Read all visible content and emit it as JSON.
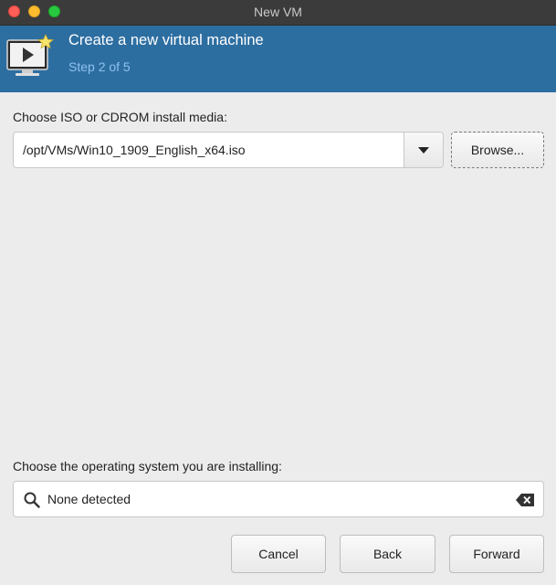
{
  "window": {
    "title": "New VM"
  },
  "banner": {
    "title": "Create a new virtual machine",
    "step": "Step 2 of 5",
    "icon": "vm-screen-new-icon"
  },
  "media": {
    "label": "Choose ISO or CDROM install media:",
    "value": "/opt/VMs/Win10_1909_English_x64.iso",
    "browse_label": "Browse..."
  },
  "os": {
    "label": "Choose the operating system you are installing:",
    "value": "None detected"
  },
  "footer": {
    "cancel_label": "Cancel",
    "back_label": "Back",
    "forward_label": "Forward"
  },
  "colors": {
    "banner": "#2d6ea1",
    "step_text": "#8ec1ee",
    "close": "#ff5f57",
    "minimize": "#febc2e",
    "maximize": "#28c840"
  }
}
